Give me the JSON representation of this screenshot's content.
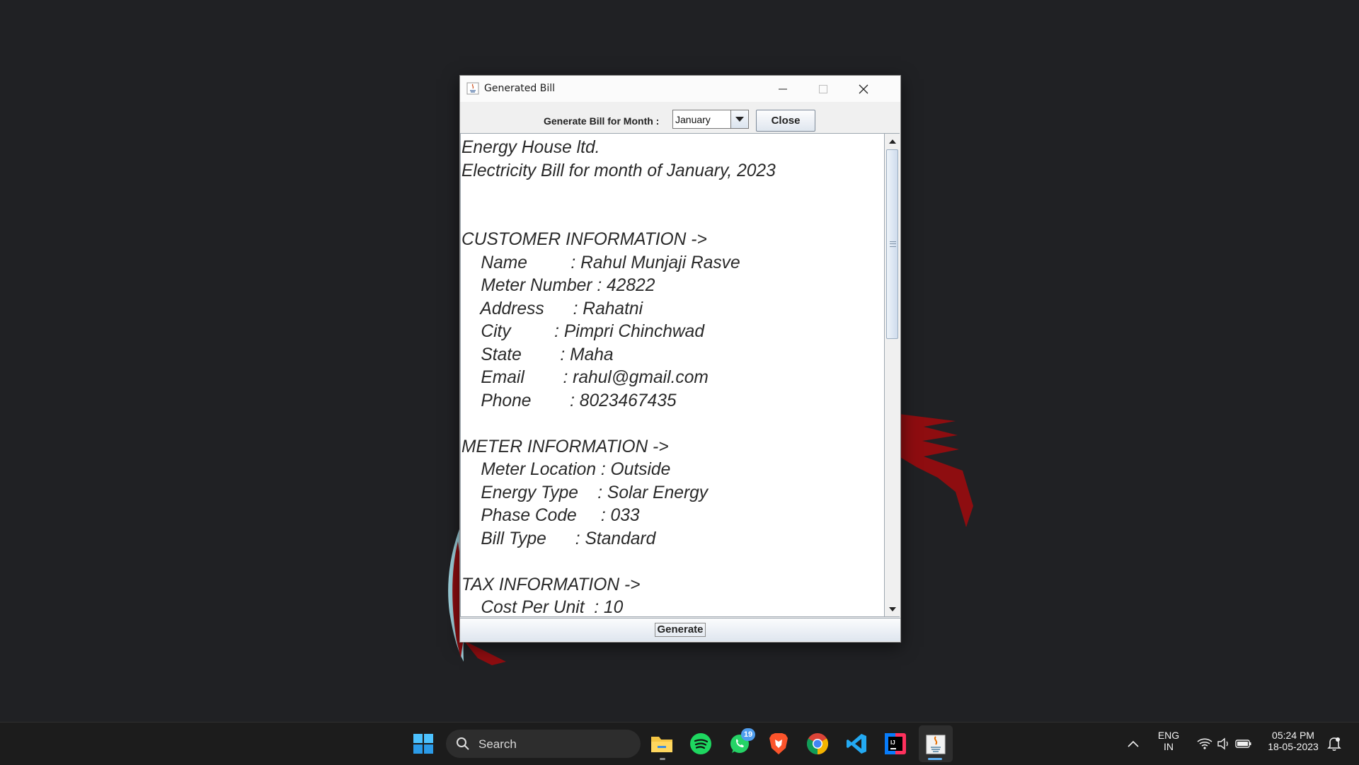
{
  "window": {
    "title": "Generated Bill",
    "generate_month_label": "Generate Bill for Month :",
    "selected_month": "January",
    "close_label": "Close",
    "generate_label": "Generate"
  },
  "bill_lines": [
    "Energy House ltd.",
    "Electricity Bill for month of January, 2023",
    "",
    "",
    "CUSTOMER INFORMATION ->",
    "    Name         : Rahul Munjaji Rasve",
    "    Meter Number : 42822",
    "    Address      : Rahatni",
    "    City         : Pimpri Chinchwad",
    "    State        : Maha",
    "    Email        : rahul@gmail.com",
    "    Phone        : 8023467435",
    "",
    "METER INFORMATION ->",
    "    Meter Location : Outside",
    "    Energy Type    : Solar Energy",
    "    Phase Code     : 033",
    "    Bill Type      : Standard",
    "",
    "TAX INFORMATION ->",
    "    Cost Per Unit  : 10"
  ],
  "taskbar": {
    "search_placeholder": "Search",
    "whatsapp_badge": "19",
    "language": "ENG",
    "region": "IN",
    "time": "05:24 PM",
    "date": "18-05-2023"
  }
}
